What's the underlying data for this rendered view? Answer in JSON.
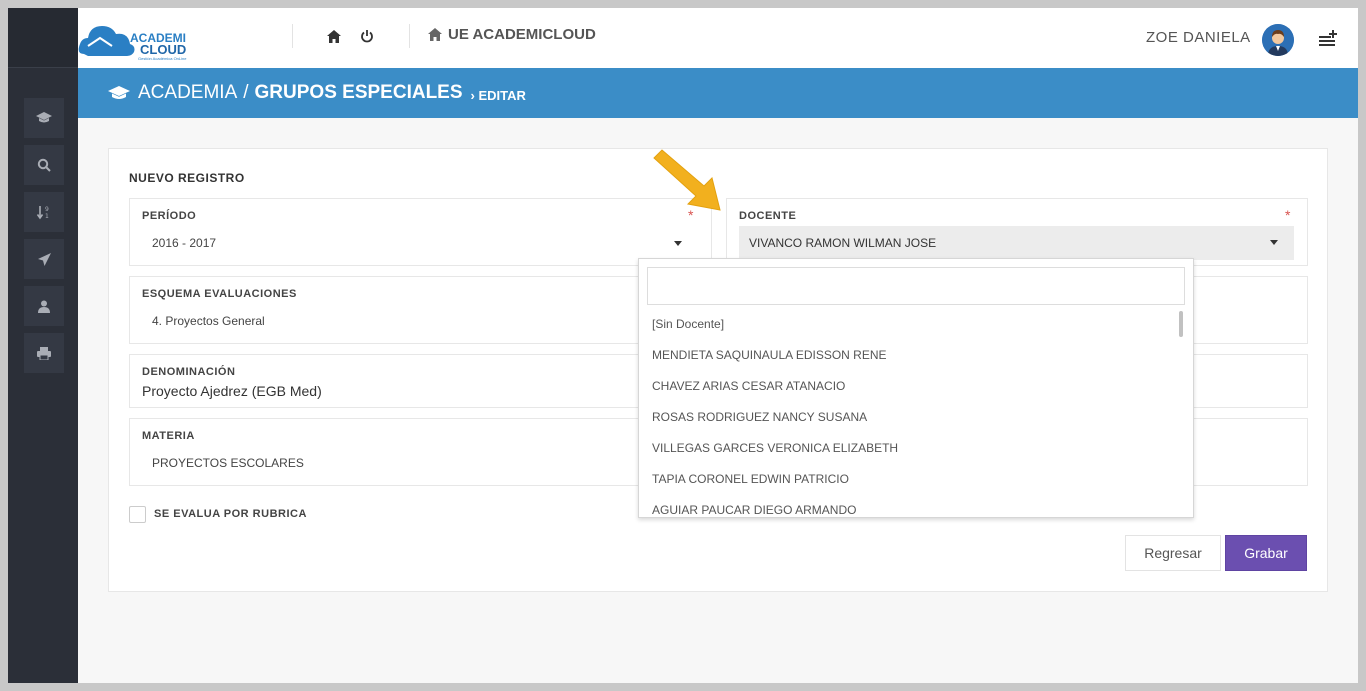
{
  "logo": {
    "line1": "ACADEMI",
    "line2": "CLOUD",
    "tagline": "Gestión Académica OnLine"
  },
  "topbar": {
    "school": "UE ACADEMICLOUD",
    "user": "ZOE DANIELA"
  },
  "breadcrumb": {
    "section": "ACADEMIA",
    "separator": "/",
    "page": "GRUPOS ESPECIALES",
    "action": "EDITAR"
  },
  "form": {
    "title": "NUEVO REGISTRO",
    "periodo": {
      "label": "PERÍODO",
      "value": "2016 - 2017",
      "required_mark": "*"
    },
    "docente": {
      "label": "DOCENTE",
      "value": "VIVANCO RAMON WILMAN JOSE",
      "required_mark": "*"
    },
    "esquema": {
      "label": "ESQUEMA EVALUACIONES",
      "value": "4. Proyectos General"
    },
    "denominacion": {
      "label": "DENOMINACIÓN",
      "value": "Proyecto Ajedrez (EGB Med)"
    },
    "materia": {
      "label": "MATERIA",
      "value": "PROYECTOS ESCOLARES"
    },
    "rubrica_label": "SE EVALUA POR RUBRICA"
  },
  "dropdown": {
    "search_value": "",
    "options": [
      "[Sin Docente]",
      "MENDIETA SAQUINAULA EDISSON RENE",
      "CHAVEZ ARIAS CESAR ATANACIO",
      "ROSAS RODRIGUEZ NANCY SUSANA",
      "VILLEGAS GARCES VERONICA ELIZABETH",
      "TAPIA CORONEL EDWIN PATRICIO",
      "AGUIAR PAUCAR DIEGO ARMANDO"
    ]
  },
  "buttons": {
    "back": "Regresar",
    "save": "Grabar"
  },
  "colors": {
    "banner": "#3b8dc7",
    "sidebar": "#2b2f38",
    "primary_button": "#6b4fb0",
    "arrow": "#f2b01e"
  }
}
